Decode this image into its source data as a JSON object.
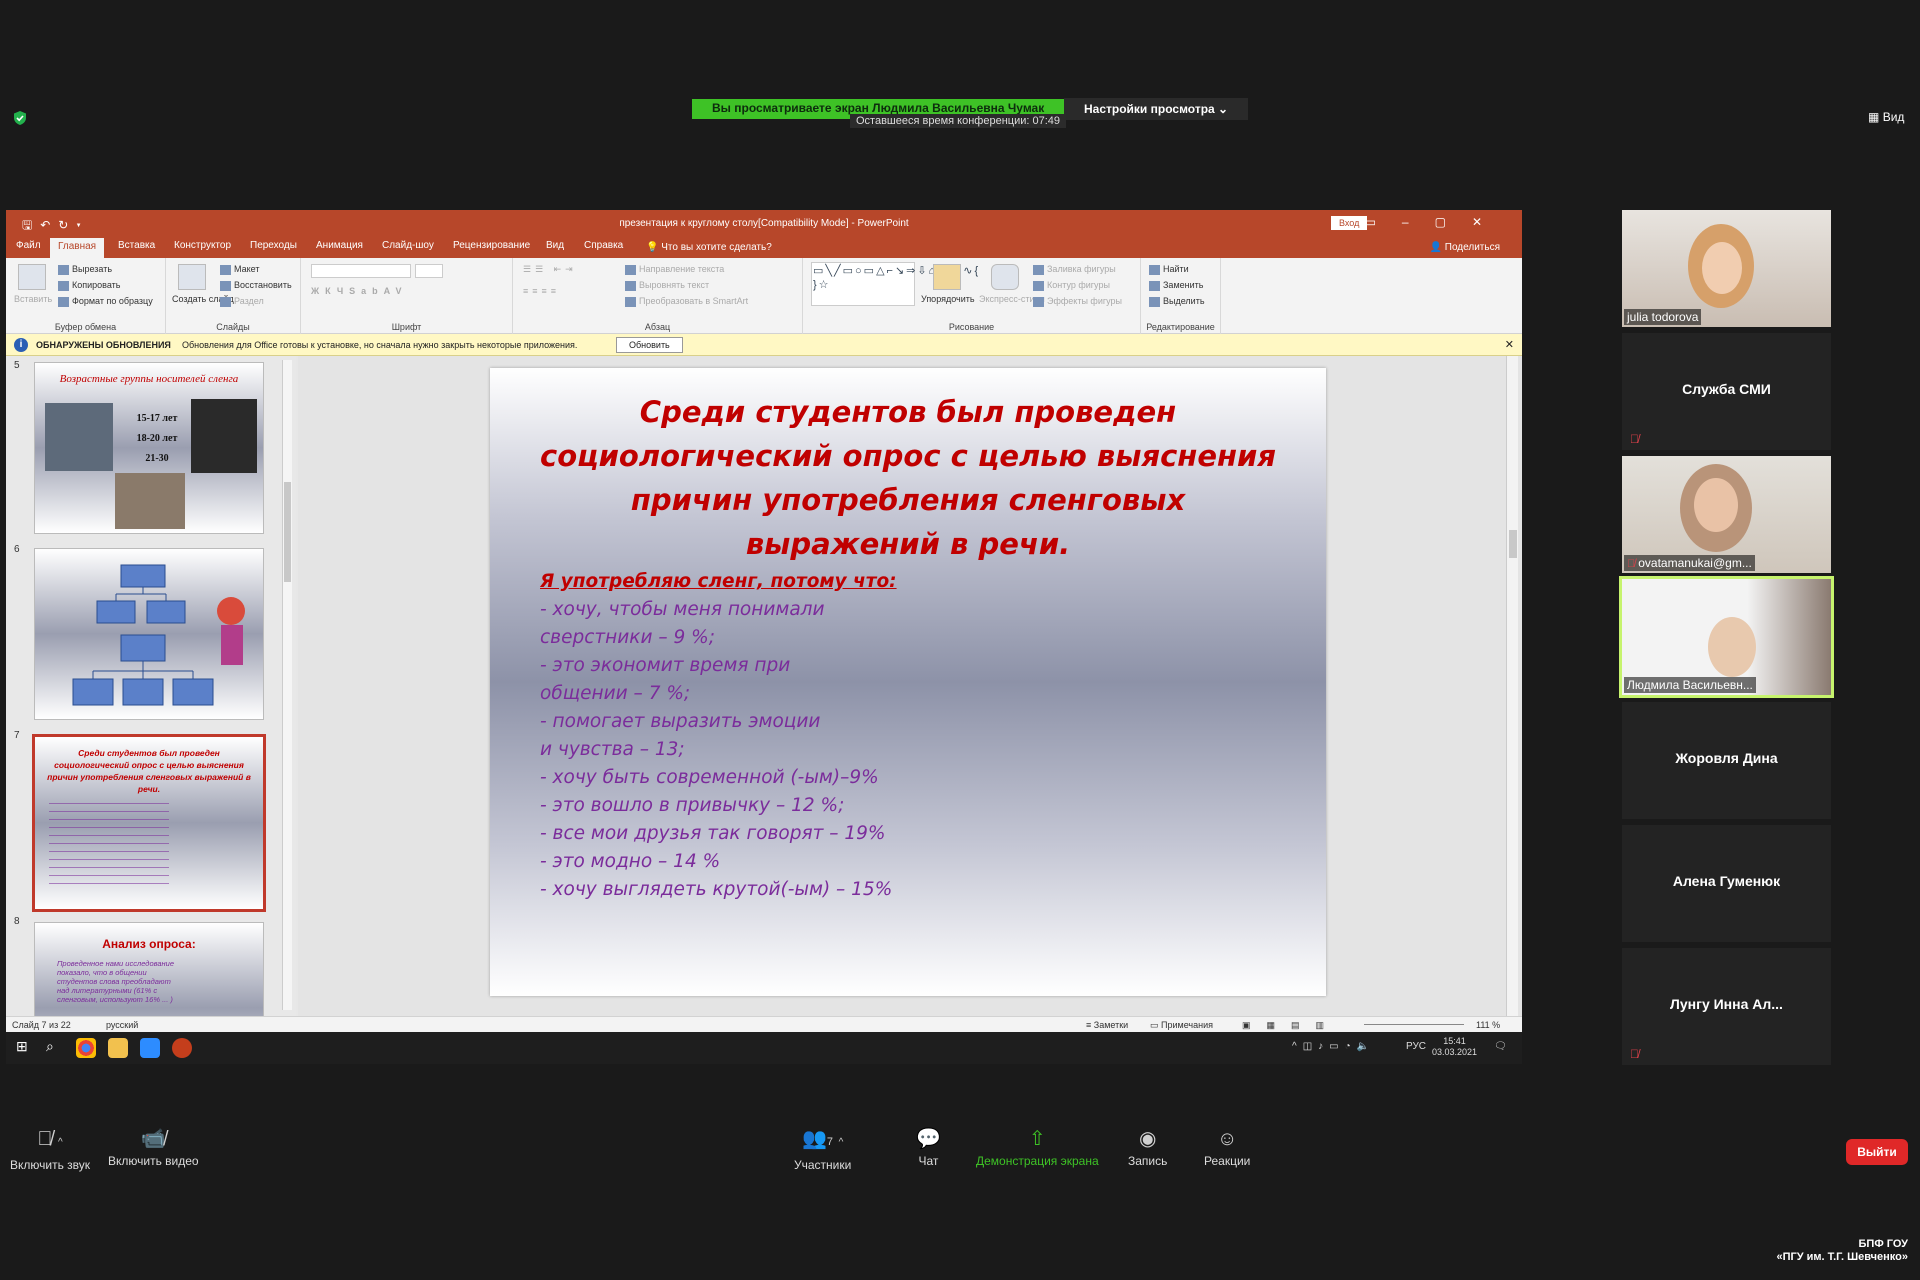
{
  "zoom": {
    "share_banner": "Вы просматриваете экран Людмила Васильевна Чумак",
    "view_settings": "Настройки просмотра",
    "remaining_time": "Оставшееся время конференции: 07:49",
    "view_button": "Вид"
  },
  "ppt": {
    "title": "презентация к круглому столу[Compatibility Mode]  -  PowerPoint",
    "signin": "Вход",
    "tabs": [
      "Файл",
      "Главная",
      "Вставка",
      "Конструктор",
      "Переходы",
      "Анимация",
      "Слайд-шоу",
      "Рецензирование",
      "Вид",
      "Справка"
    ],
    "search_hint": "Что вы хотите сделать?",
    "share": "Поделиться",
    "ribbon": {
      "clipboard": {
        "paste": "Вставить",
        "cut": "Вырезать",
        "copy": "Копировать",
        "format": "Формат по образцу",
        "label": "Буфер обмена"
      },
      "slides": {
        "create": "Создать слайд",
        "layout": "Макет",
        "reset": "Восстановить",
        "section": "Раздел",
        "label": "Слайды"
      },
      "font": {
        "label": "Шрифт"
      },
      "paragraph": {
        "direction": "Направление текста",
        "align": "Выровнять текст",
        "smartart": "Преобразовать в SmartArt",
        "label": "Абзац"
      },
      "drawing": {
        "arrange": "Упорядочить",
        "styles": "Экспресс-стили",
        "fill": "Заливка фигуры",
        "outline": "Контур фигуры",
        "effects": "Эффекты фигуры",
        "label": "Рисование"
      },
      "editing": {
        "find": "Найти",
        "replace": "Заменить",
        "select": "Выделить",
        "label": "Редактирование"
      }
    },
    "update_bar": {
      "title": "ОБНАРУЖЕНЫ ОБНОВЛЕНИЯ",
      "message": "Обновления для Office готовы к установке, но сначала нужно закрыть некоторые приложения.",
      "button": "Обновить"
    },
    "thumbnails": [
      {
        "num": "5",
        "title": "Возрастные группы носителей сленга",
        "ages": [
          "15-17 лет",
          "18-20 лет",
          "21-30"
        ]
      },
      {
        "num": "6",
        "title": ""
      },
      {
        "num": "7",
        "title": "Среди студентов был проведен социологический опрос с целью выяснения причин употребления сленговых выражений в речи."
      },
      {
        "num": "8",
        "title": "Анализ опроса:",
        "body": "Проведенное нами исследование показало, что в общении студентов слова преобладают над литературными (61% с сленговым, используют 16% ... )"
      }
    ],
    "slide": {
      "title": "Среди студентов  был проведен социологический опрос с целью выяснения причин употребления сленговых выражений в речи.",
      "lead": "Я употребляю сленг, потому что:",
      "lines": [
        "- хочу, чтобы меня понимали",
        "сверстники – 9 %;",
        "- это экономит время при",
        "общении – 7 %;",
        "- помогает выразить эмоции",
        "и чувства – 13;",
        "- хочу быть современной (-ым)–9%",
        "- это вошло в привычку – 12 %;",
        "- все мои друзья так говорят – 19%",
        "- это модно – 14 %",
        "- хочу выглядеть крутой(-ым) – 15%"
      ]
    },
    "status": {
      "slide": "Слайд 7 из 22",
      "lang": "русский",
      "notes": "Заметки",
      "comments": "Примечания",
      "zoom": "111 %"
    }
  },
  "taskbar": {
    "lang": "РУС",
    "time": "15:41",
    "date": "03.03.2021"
  },
  "participants": [
    {
      "name": "julia todorova",
      "video": true
    },
    {
      "name": "Служба СМИ",
      "video": false,
      "muted": true
    },
    {
      "name": "ovatamanukai@gm...",
      "video": true,
      "muted": true
    },
    {
      "name": "Людмила Васильевн...",
      "video": true,
      "active": true
    },
    {
      "name": "Жоровля Дина",
      "video": false
    },
    {
      "name": "Алена Гуменюк",
      "video": false
    },
    {
      "name": "Лунгу Инна Ал...",
      "video": false,
      "muted": true
    }
  ],
  "toolbar": {
    "audio": "Включить звук",
    "video": "Включить видео",
    "participants": "Участники",
    "participants_count": "7",
    "chat": "Чат",
    "share": "Демонстрация экрана",
    "record": "Запись",
    "reactions": "Реакции",
    "leave": "Выйти"
  },
  "watermark": {
    "line1": "БПФ ГОУ",
    "line2": "«ПГУ им. Т.Г. Шевченко»"
  },
  "colors": {
    "ppt_red": "#b7472a",
    "slide_title": "#c00000",
    "slide_body": "#7b2c9b",
    "zoom_green": "#3ec226",
    "leave_red": "#e02828"
  }
}
